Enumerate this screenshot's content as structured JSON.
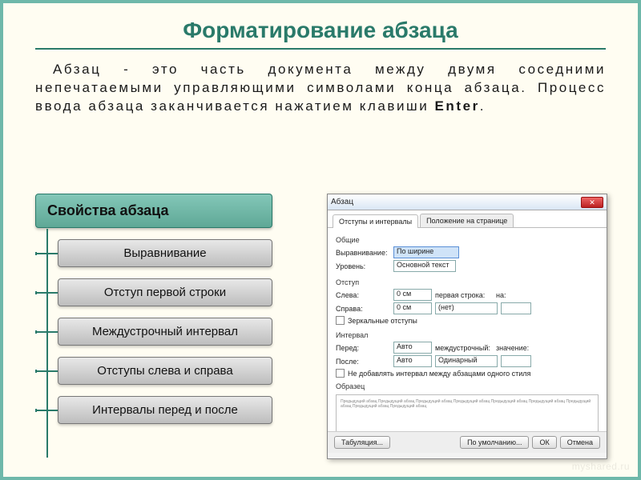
{
  "slide": {
    "title": "Форматирование абзаца",
    "description_pre": "Абзац - это часть документа между двумя соседними непечатаемыми управляющими символами конца абзаца. Процесс ввода абзаца заканчивается нажатием клавиши ",
    "description_bold": "Enter",
    "description_post": "."
  },
  "properties": {
    "heading": "Свойства абзаца",
    "items": [
      "Выравнивание",
      "Отступ первой строки",
      "Междустрочный интервал",
      "Отступы слева и справа",
      "Интервалы перед и после"
    ]
  },
  "dialog": {
    "title": "Абзац",
    "close": "✕",
    "tabs": [
      "Отступы и интервалы",
      "Положение на странице"
    ],
    "groups": {
      "general": "Общие",
      "indent": "Отступ",
      "spacing": "Интервал",
      "sample": "Образец"
    },
    "labels": {
      "alignment": "Выравнивание:",
      "level": "Уровень:",
      "left": "Слева:",
      "right": "Справа:",
      "firstline": "первая строка:",
      "by": "на:",
      "mirror": "Зеркальные отступы",
      "before": "Перед:",
      "after": "После:",
      "linesp": "междустрочный:",
      "value": "значение:",
      "nospace": "Не добавлять интервал между абзацами одного стиля"
    },
    "values": {
      "alignment": "По ширине",
      "level": "Основной текст",
      "left": "0 см",
      "right": "0 см",
      "firstline": "(нет)",
      "before": "Авто",
      "after": "Авто",
      "linesp": "Одинарный"
    },
    "buttons": {
      "tabstops": "Табуляция...",
      "default": "По умолчанию...",
      "ok": "ОК",
      "cancel": "Отмена"
    },
    "preview_text": "Предыдущий абзац Предыдущий абзац Предыдущий абзац Предыдущий абзац Предыдущий абзац Предыдущий абзац Предыдущий абзац Предыдущий абзац Предыдущий абзац"
  },
  "watermark": "myshared.ru"
}
